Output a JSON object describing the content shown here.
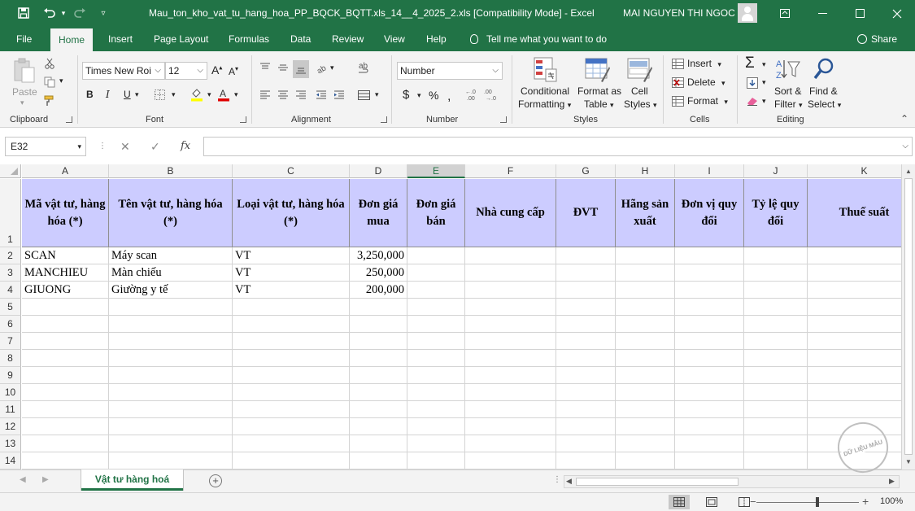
{
  "window": {
    "title": "Mau_ton_kho_vat_tu_hang_hoa_PP_BQCK_BQTT.xls_14__4_2025_2.xls  [Compatibility Mode]  -  Excel",
    "user": "MAI NGUYEN THI NGOC"
  },
  "ribbon_tabs": [
    "File",
    "Home",
    "Insert",
    "Page Layout",
    "Formulas",
    "Data",
    "Review",
    "View",
    "Help"
  ],
  "tell_me": "Tell me what you want to do",
  "share": "Share",
  "clipboard": {
    "paste": "Paste",
    "label": "Clipboard"
  },
  "font": {
    "name": "Times New Roi",
    "size": "12",
    "label": "Font",
    "bold": "B",
    "italic": "I",
    "underline": "U"
  },
  "alignment": {
    "label": "Alignment"
  },
  "number": {
    "format": "Number",
    "label": "Number",
    "currency": "$",
    "percent": "%"
  },
  "styles": {
    "conditional_1": "Conditional",
    "conditional_2": "Formatting",
    "format_table_1": "Format as",
    "format_table_2": "Table",
    "cell_styles_1": "Cell",
    "cell_styles_2": "Styles",
    "label": "Styles"
  },
  "cells": {
    "insert": "Insert",
    "delete": "Delete",
    "format": "Format",
    "label": "Cells"
  },
  "editing": {
    "sort_1": "Sort &",
    "sort_2": "Filter",
    "find_1": "Find &",
    "find_2": "Select",
    "label": "Editing"
  },
  "formula_bar": {
    "name_box": "E32",
    "fx": "fx",
    "value": ""
  },
  "columns": [
    "A",
    "B",
    "C",
    "D",
    "E",
    "F",
    "G",
    "H",
    "I",
    "J",
    "K"
  ],
  "selected_column": "E",
  "header_row": {
    "A": "Mã vật tư, hàng hóa (*)",
    "B": "Tên vật tư, hàng hóa (*)",
    "C": "Loại vật tư, hàng hóa (*)",
    "D": "Đơn giá mua",
    "E": "Đơn giá bán",
    "F": "Nhà cung cấp",
    "G": "ĐVT",
    "H": "Hãng sản xuất",
    "I": "Đơn vị quy đổi",
    "J": "Tỷ lệ quy đổi",
    "K": "Thuế suất"
  },
  "rows": [
    {
      "row": "2",
      "A": "SCAN",
      "B": "Máy scan",
      "C": "VT",
      "D": "3,250,000"
    },
    {
      "row": "3",
      "A": "MANCHIEU",
      "B": "Màn chiếu",
      "C": "VT",
      "D": "250,000"
    },
    {
      "row": "4",
      "A": "GIUONG",
      "B": "Giường y tế",
      "C": "VT",
      "D": "200,000"
    }
  ],
  "row_numbers": [
    "1",
    "2",
    "3",
    "4",
    "5",
    "6",
    "7",
    "8",
    "9",
    "10",
    "11",
    "12",
    "13",
    "14"
  ],
  "sheet_tab": "Vật tư hàng hoá",
  "status": {
    "zoom": "100%",
    "zoom_minus": "−",
    "zoom_plus": "+"
  },
  "watermark": "DỮ LIỆU MẪU",
  "colors": {
    "excel_green": "#217346",
    "header_fill": "#ccccff"
  }
}
